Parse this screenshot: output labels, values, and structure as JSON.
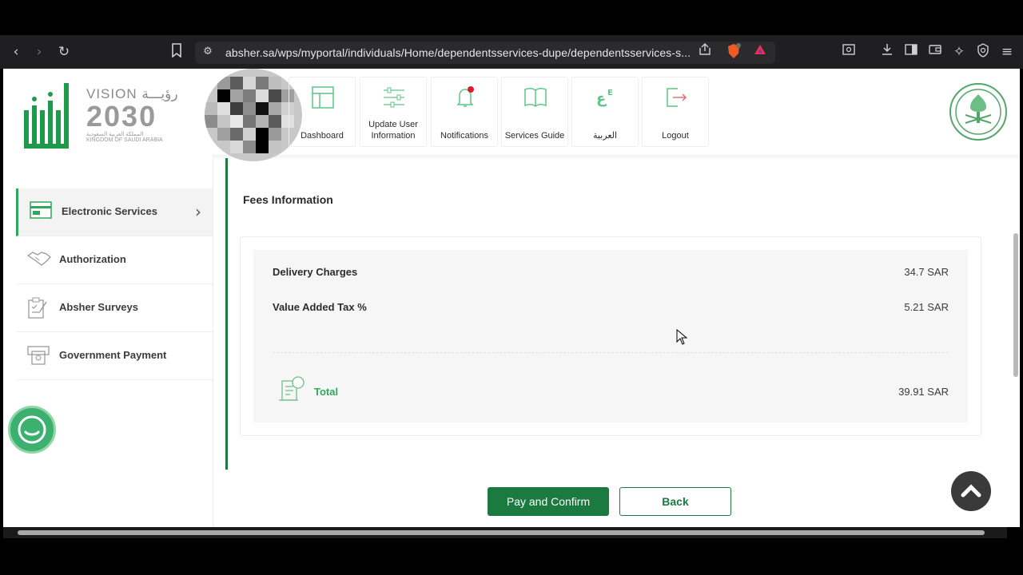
{
  "browser": {
    "url": "absher.sa/wps/myportal/individuals/Home/dependentsservices-dupe/dependentsservices-s...",
    "icons": [
      "back-icon",
      "forward-icon",
      "reload-icon",
      "bookmark-icon",
      "site-settings-icon",
      "share-icon",
      "brave-shield-icon",
      "rewards-icon",
      "tab-search-icon",
      "download-icon",
      "sidebar-icon",
      "wallet-icon",
      "leo-icon",
      "vpn-icon",
      "menu-icon"
    ]
  },
  "header": {
    "vision_line1": "VISION رؤيـــة",
    "vision_year": "2030",
    "vision_line3": "المملكة العربية السعودية",
    "vision_line4": "KINGDOM OF SAUDI ARABIA",
    "nav": [
      {
        "label": "Dashboard",
        "icon": "dashboard-icon"
      },
      {
        "label": "Update User Information",
        "icon": "sliders-icon"
      },
      {
        "label": "Notifications",
        "icon": "bell-icon"
      },
      {
        "label": "Services Guide",
        "icon": "book-icon"
      },
      {
        "label": "العربية",
        "icon": "language-icon"
      },
      {
        "label": "Logout",
        "icon": "logout-icon"
      }
    ]
  },
  "sidebar": {
    "items": [
      {
        "label": "Electronic Services",
        "icon": "electronic-services-icon",
        "active": true
      },
      {
        "label": "Authorization",
        "icon": "handshake-icon"
      },
      {
        "label": "Absher Surveys",
        "icon": "survey-icon"
      },
      {
        "label": "Government Payment",
        "icon": "atm-icon"
      }
    ]
  },
  "main": {
    "section_title": "Fees Information",
    "fees": [
      {
        "label": "Delivery Charges",
        "value": "34.7 SAR"
      },
      {
        "label": "Value Added Tax %",
        "value": "5.21 SAR"
      }
    ],
    "total_label": "Total",
    "total_value": "39.91 SAR",
    "pay_button": "Pay and Confirm",
    "back_button": "Back"
  },
  "colors": {
    "brand_green": "#1b7a3f",
    "accent_green": "#2ea85a",
    "notification_dot": "#d9202a"
  }
}
